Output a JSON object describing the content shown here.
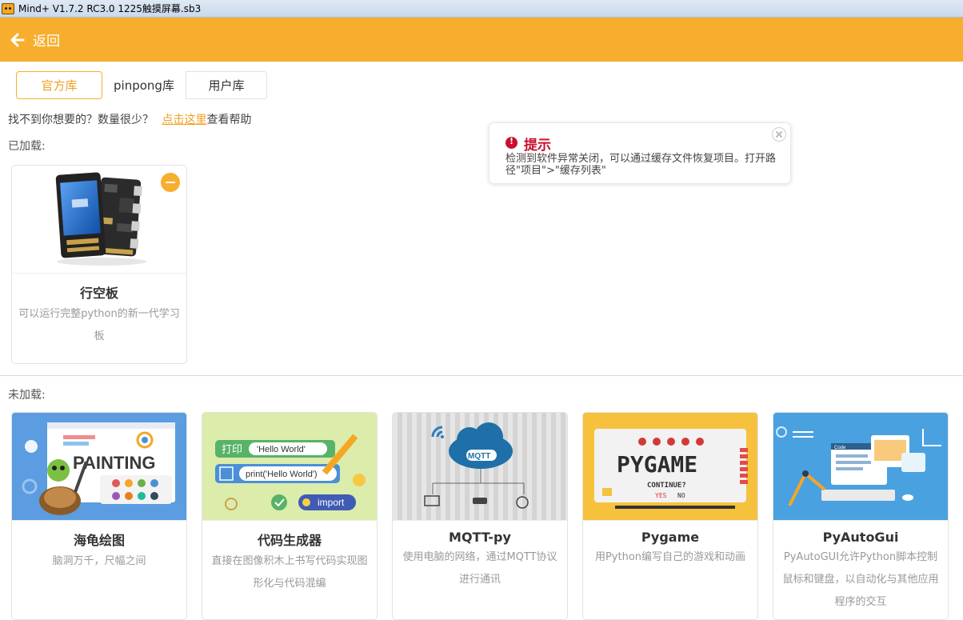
{
  "window": {
    "title": "Mind+ V1.7.2 RC3.0    1225触摸屏幕.sb3"
  },
  "header": {
    "back_label": "返回"
  },
  "tabs": [
    {
      "label": "官方库",
      "active": true
    },
    {
      "label": "pinpong库",
      "active": false
    },
    {
      "label": "用户库",
      "active": false
    }
  ],
  "help": {
    "prefix": "找不到你想要的？数量很少？",
    "link": "点击这里",
    "suffix": "查看帮助"
  },
  "loaded": {
    "label": "已加载:",
    "items": [
      {
        "title": "行空板",
        "desc": "可以运行完整python的新一代学习板",
        "icon": "unihiker-board-image"
      }
    ]
  },
  "unloaded": {
    "label": "未加载:",
    "items": [
      {
        "title": "海龟绘图",
        "desc": "脑洞万千，尺幅之间",
        "thumb_text": "PAINTING"
      },
      {
        "title": "代码生成器",
        "desc": "直接在图像积木上书写代码实现图形化与代码混编",
        "thumb": {
          "block1": "打印",
          "str1": "'Hello World'",
          "str2": "print('Hello World')",
          "badge": "import"
        }
      },
      {
        "title": "MQTT-py",
        "desc": "使用电脑的网络，通过MQTT协议进行通讯",
        "thumb_text": "MQTT"
      },
      {
        "title": "Pygame",
        "desc": "用Python编写自己的游戏和动画",
        "thumb": {
          "logo": "PYGAME",
          "continue": "CONTINUE?",
          "yes": "YES",
          "no": "NO"
        }
      },
      {
        "title": "PyAutoGui",
        "desc": "PyAutoGUI允许Python脚本控制鼠标和键盘，以自动化与其他应用程序的交互",
        "thumb_text": "Code"
      }
    ]
  },
  "toast": {
    "title": "提示",
    "body": "检测到软件异常关闭，可以通过缓存文件恢复项目。打开路径\"项目\">\"缓存列表\""
  },
  "colors": {
    "accent": "#f7ae2e",
    "alert": "#c8102e",
    "link": "#f0a020"
  }
}
